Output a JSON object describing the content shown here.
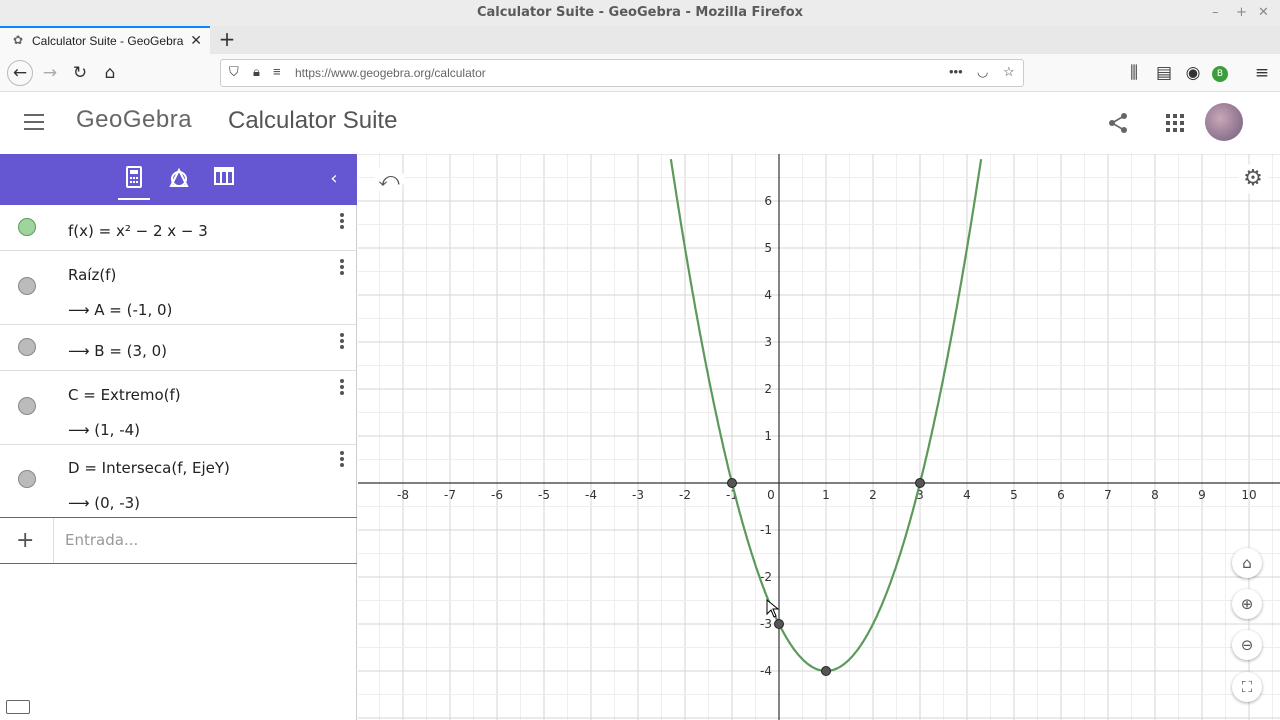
{
  "window": {
    "title": "Calculator Suite - GeoGebra - Mozilla Firefox"
  },
  "tab": {
    "title": "Calculator Suite - GeoGebra"
  },
  "browser": {
    "url": "https://www.geogebra.org/calculator"
  },
  "app": {
    "logo": "GeoGebra",
    "title": "Calculator Suite"
  },
  "algebra": {
    "rows": [
      {
        "expr": "f(x) = x² − 2 x − 3"
      },
      {
        "expr": "Raíz(f)",
        "result": "⟶ A = (-1, 0)"
      },
      {
        "expr": "⟶ B = (3, 0)"
      },
      {
        "expr": "C = Extremo(f)",
        "result": "⟶ (1, -4)"
      },
      {
        "expr": "D = Interseca(f, EjeY)",
        "result": "⟶ (0, -3)"
      }
    ],
    "input_placeholder": "Entrada..."
  },
  "graph": {
    "function": "x^2 - 2x - 3",
    "curve_color": "#5b9a5b",
    "x_ticks": [
      "-8",
      "-7",
      "-6",
      "-5",
      "-4",
      "-3",
      "-2",
      "-1",
      "0",
      "1",
      "2",
      "3",
      "4",
      "5",
      "6",
      "7",
      "8",
      "9",
      "10"
    ],
    "y_ticks": [
      "6",
      "5",
      "4",
      "3",
      "2",
      "1",
      "-1",
      "-2",
      "-3",
      "-4"
    ],
    "points": [
      {
        "name": "A",
        "x": -1,
        "y": 0
      },
      {
        "name": "B",
        "x": 3,
        "y": 0
      },
      {
        "name": "C",
        "x": 1,
        "y": -4
      },
      {
        "name": "D",
        "x": 0,
        "y": -3
      }
    ]
  },
  "icons": {
    "undo": "undo-icon",
    "settings": "gear-icon",
    "home": "home-icon",
    "zoom_in": "zoom-in-icon",
    "zoom_out": "zoom-out-icon",
    "fullscreen": "fullscreen-icon"
  }
}
